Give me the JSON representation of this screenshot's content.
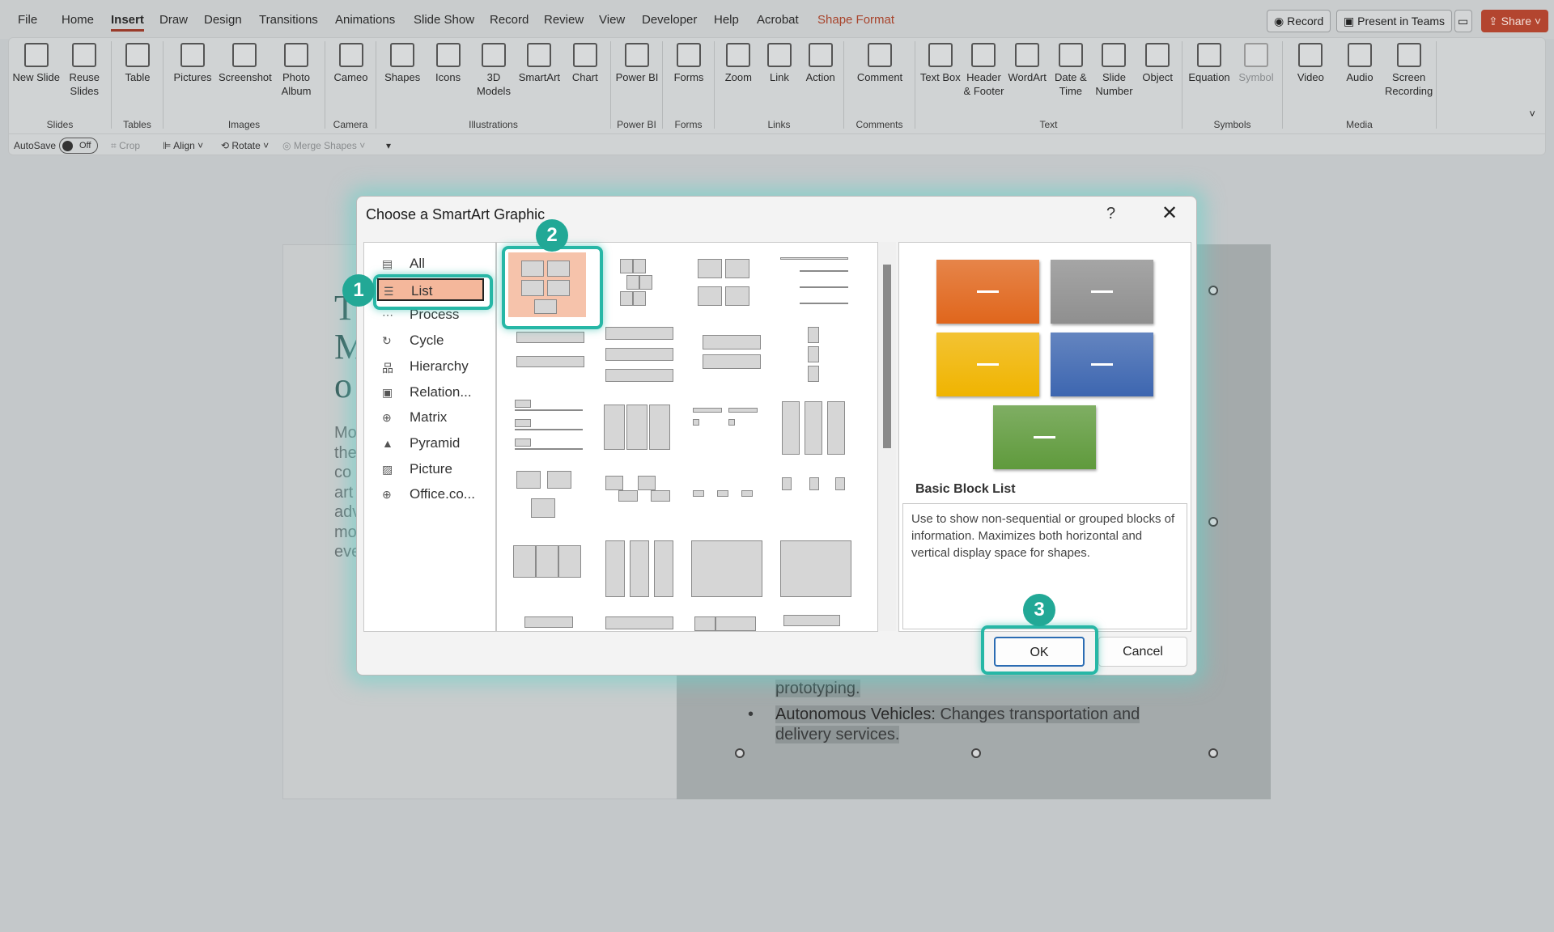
{
  "menu": {
    "tabs": [
      "File",
      "Home",
      "Insert",
      "Draw",
      "Design",
      "Transitions",
      "Animations",
      "Slide Show",
      "Record",
      "Review",
      "View",
      "Developer",
      "Help",
      "Acrobat",
      "Shape Format"
    ],
    "active": "Insert",
    "contextual": "Shape Format"
  },
  "topbar": {
    "record": "Record",
    "present": "Present in Teams",
    "share": "Share"
  },
  "ribbon": {
    "groups": [
      {
        "label": "Slides",
        "items": [
          "New Slide",
          "Reuse Slides"
        ]
      },
      {
        "label": "Tables",
        "items": [
          "Table"
        ]
      },
      {
        "label": "Images",
        "items": [
          "Pictures",
          "Screenshot",
          "Photo Album"
        ]
      },
      {
        "label": "Camera",
        "items": [
          "Cameo"
        ]
      },
      {
        "label": "Illustrations",
        "items": [
          "Shapes",
          "Icons",
          "3D Models",
          "SmartArt",
          "Chart"
        ]
      },
      {
        "label": "Power BI",
        "items": [
          "Power BI"
        ]
      },
      {
        "label": "Forms",
        "items": [
          "Forms"
        ]
      },
      {
        "label": "Links",
        "items": [
          "Zoom",
          "Link",
          "Action"
        ]
      },
      {
        "label": "Comments",
        "items": [
          "Comment"
        ]
      },
      {
        "label": "Text",
        "items": [
          "Text Box",
          "Header & Footer",
          "WordArt",
          "Date & Time",
          "Slide Number",
          "Object"
        ]
      },
      {
        "label": "Symbols",
        "items": [
          "Equation",
          "Symbol"
        ]
      },
      {
        "label": "Media",
        "items": [
          "Video",
          "Audio",
          "Screen Recording"
        ]
      }
    ]
  },
  "qat": {
    "autosave": "AutoSave",
    "toggle": "Off",
    "crop": "Crop",
    "align": "Align",
    "rotate": "Rotate",
    "merge": "Merge Shapes"
  },
  "slide": {
    "left_big": [
      "T",
      "M",
      "o"
    ],
    "left_text": [
      "Mo",
      "the",
      "co",
      "art",
      "adv",
      "mo",
      "eve"
    ],
    "bullet1_tail": "prototyping.",
    "bullet2_bold": "Autonomous Vehicles:",
    "bullet2_rest": " Changes transportation and",
    "bullet2_line2": "delivery services."
  },
  "dialog": {
    "title": "Choose a SmartArt Graphic",
    "help": "?",
    "close": "✕",
    "categories": [
      {
        "label": "All",
        "icon": "▤"
      },
      {
        "label": "List",
        "icon": "☰"
      },
      {
        "label": "Process",
        "icon": "⋯"
      },
      {
        "label": "Cycle",
        "icon": "↻"
      },
      {
        "label": "Hierarchy",
        "icon": "品"
      },
      {
        "label": "Relation...",
        "icon": "▣"
      },
      {
        "label": "Matrix",
        "icon": "⊕"
      },
      {
        "label": "Pyramid",
        "icon": "▲"
      },
      {
        "label": "Picture",
        "icon": "▨"
      },
      {
        "label": "Office.co...",
        "icon": "⊕"
      }
    ],
    "selected_category": "List",
    "selected_layout": "Basic Block List",
    "description": "Use to show non-sequential or grouped blocks of information. Maximizes both horizontal and vertical display space for shapes.",
    "swatch_colors": [
      "#e0661c",
      "#8f8f8f",
      "#f0b400",
      "#3d66b0",
      "#5f9a3c"
    ],
    "ok": "OK",
    "cancel": "Cancel"
  },
  "callouts": [
    "1",
    "2",
    "3"
  ],
  "accent": "#22a896"
}
